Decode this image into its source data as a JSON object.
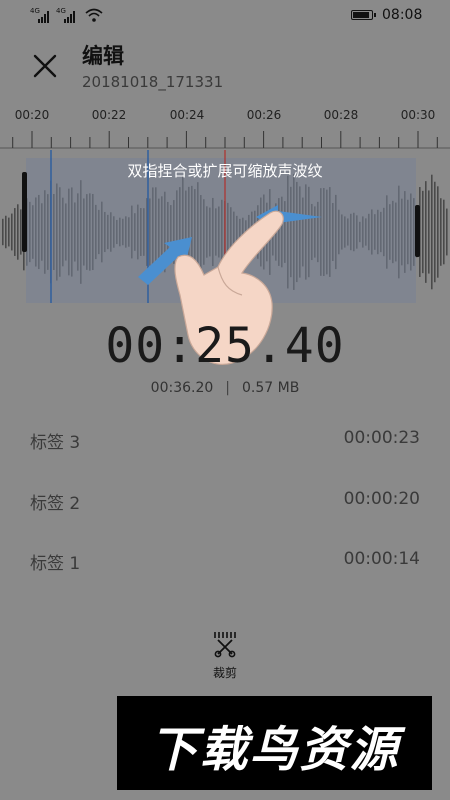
{
  "status_bar": {
    "network_1": "4G",
    "network_2": "4G",
    "time": "08:08"
  },
  "header": {
    "title": "编辑",
    "filename": "20181018_171331"
  },
  "timeline": {
    "ticks": [
      "00:20",
      "00:22",
      "00:24",
      "00:26",
      "00:28",
      "00:30"
    ]
  },
  "waveform": {
    "hint": "双指捏合或扩展可缩放声波纹",
    "selection_color": "#7a8296",
    "marker_color": "#2f5f9e",
    "playhead_color": "#b0302c"
  },
  "player": {
    "current_time": "00:25.40",
    "duration": "00:36.20",
    "size": "0.57 MB"
  },
  "tags": [
    {
      "name": "标签 3",
      "time": "00:00:23"
    },
    {
      "name": "标签 2",
      "time": "00:00:20"
    },
    {
      "name": "标签 1",
      "time": "00:00:14"
    }
  ],
  "toolbar": {
    "cut_label": "裁剪"
  },
  "watermark": {
    "text": "下载鸟资源"
  },
  "icons": {
    "close": "close-icon",
    "scissors": "scissors-icon",
    "wifi": "wifi-icon",
    "battery": "battery-icon"
  }
}
